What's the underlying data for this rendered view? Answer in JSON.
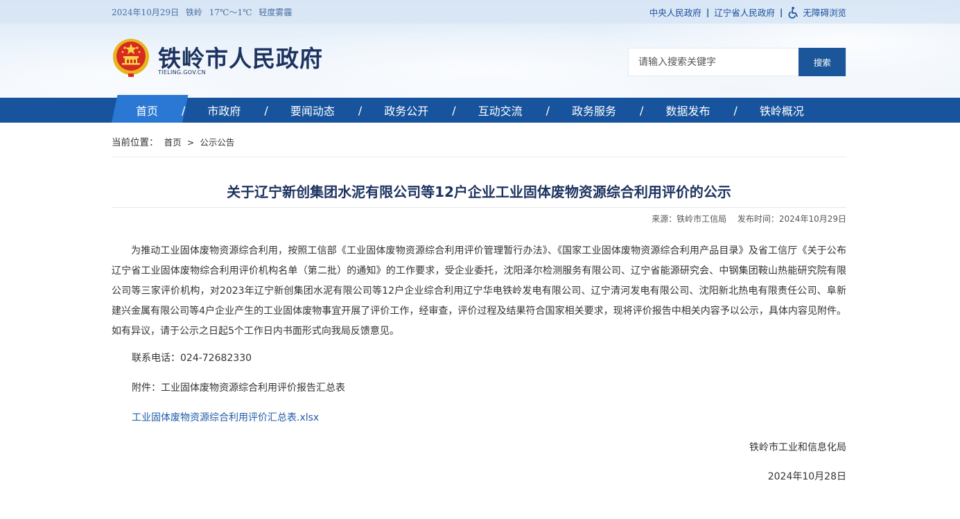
{
  "topbar": {
    "date": "2024年10月29日",
    "city": "铁岭",
    "temperature": "17℃～1℃",
    "weather": "轻度雾霾",
    "links": [
      "中央人民政府",
      "辽宁省人民政府"
    ],
    "accessibility": "无障碍浏览"
  },
  "site": {
    "title": "铁岭市人民政府",
    "domain": "TIELING.GOV.CN"
  },
  "search": {
    "placeholder": "请输入搜索关键字",
    "button": "搜索"
  },
  "nav": {
    "items": [
      "首页",
      "市政府",
      "要闻动态",
      "政务公开",
      "互动交流",
      "政务服务",
      "数据发布",
      "铁岭概况"
    ],
    "separator": "/",
    "active": "首页"
  },
  "breadcrumb": {
    "label": "当前位置：",
    "items": [
      "首页",
      "公示公告"
    ],
    "separator": ">"
  },
  "article": {
    "title": "关于辽宁新创集团水泥有限公司等12户企业工业固体废物资源综合利用评价的公示",
    "source": "来源：铁岭市工信局",
    "publish_time": "发布时间：2024年10月29日",
    "body": "为推动工业固体废物资源综合利用，按照工信部《工业固体废物资源综合利用评价管理暂行办法》、《国家工业固体废物资源综合利用产品目录》及省工信厅《关于公布辽宁省工业固体废物综合利用评价机构名单（第二批）的通知》的工作要求，受企业委托，沈阳泽尔检测服务有限公司、辽宁省能源研究会、中钢集团鞍山热能研究院有限公司等三家评价机构，对2023年辽宁新创集团水泥有限公司等12户企业综合利用辽宁华电铁岭发电有限公司、辽宁清河发电有限公司、沈阳新北热电有限责任公司、阜新建兴金属有限公司等4户企业产生的工业固体废物事宜开展了评价工作，经审查，评价过程及结果符合国家相关要求，现将评价报告中相关内容予以公示，具体内容见附件。如有异议，请于公示之日起5个工作日内书面形式向我局反馈意见。",
    "contact": "联系电话：024-72682330",
    "attachment_label": "附件：工业固体废物资源综合利用评价报告汇总表",
    "attachment_link": "工业固体废物资源综合利用评价汇总表.xlsx",
    "signer": "铁岭市工业和信息化局",
    "sign_date": "2024年10月28日"
  },
  "colors": {
    "nav_bg": "#17549d",
    "nav_active": "#2a78d3",
    "title": "#1d3360",
    "link": "#1f5ba8"
  }
}
